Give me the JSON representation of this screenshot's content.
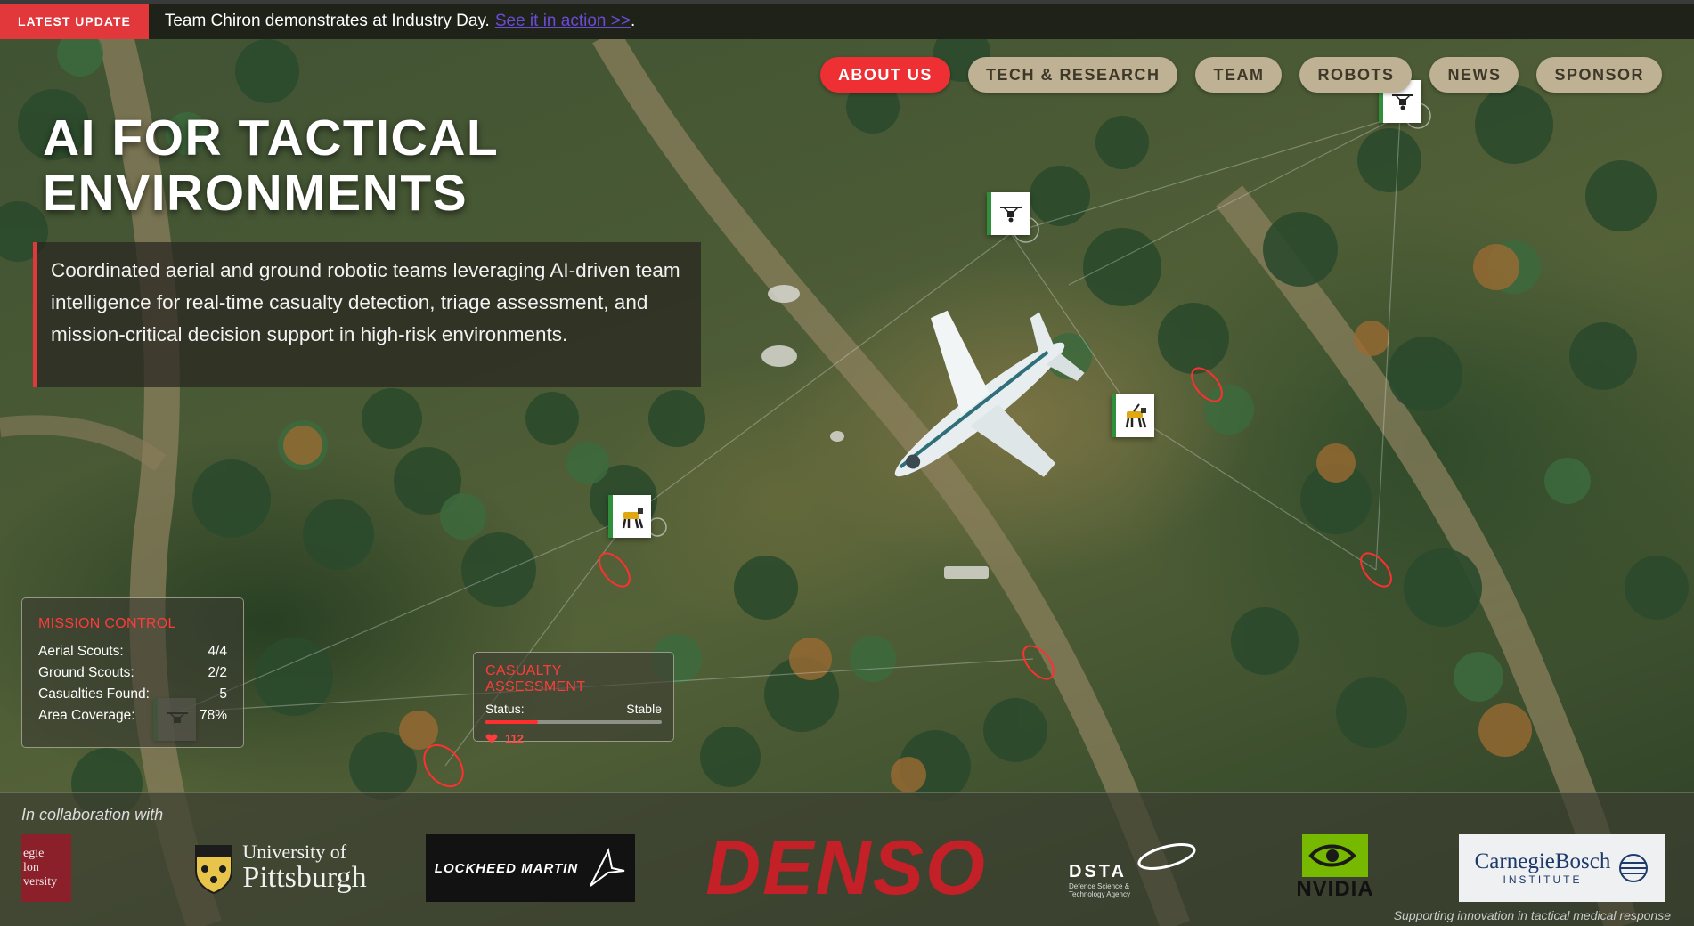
{
  "ticker": {
    "badge": "LATEST UPDATE",
    "text": "Team Chiron demonstrates at Industry Day.",
    "link": "See it in action >>",
    "suffix": "."
  },
  "nav": {
    "items": [
      {
        "label": "ABOUT US",
        "active": true
      },
      {
        "label": "TECH & RESEARCH",
        "active": false
      },
      {
        "label": "TEAM",
        "active": false
      },
      {
        "label": "ROBOTS",
        "active": false
      },
      {
        "label": "NEWS",
        "active": false
      },
      {
        "label": "SPONSOR",
        "active": false
      }
    ]
  },
  "hero": {
    "title_line1": "AI FOR TACTICAL",
    "title_line2": "ENVIRONMENTS",
    "description": "Coordinated aerial and ground robotic teams leveraging AI-driven team intelligence for real-time casualty detection, triage assessment, and mission-critical decision support in high-risk environments."
  },
  "mission_control": {
    "title": "MISSION CONTROL",
    "rows": [
      {
        "label": "Aerial Scouts:",
        "value": "4/4"
      },
      {
        "label": "Ground Scouts:",
        "value": "2/2"
      },
      {
        "label": "Casualties Found:",
        "value": "5"
      },
      {
        "label": "Area Coverage:",
        "value": "78%"
      }
    ]
  },
  "casualty_assessment": {
    "title": "CASUALTY ASSESSMENT",
    "status_label": "Status:",
    "status_value": "Stable",
    "progress": 0.3,
    "heart_rate": "112"
  },
  "partners": {
    "heading": "In collaboration with",
    "logos": [
      {
        "name": "Carnegie Mellon University",
        "text_lines": [
          "egie",
          "lon",
          "versity"
        ]
      },
      {
        "name": "University of Pittsburgh",
        "line1": "University of",
        "line2": "Pittsburgh"
      },
      {
        "name": "Lockheed Martin",
        "text": "LOCKHEED MARTIN"
      },
      {
        "name": "DENSO",
        "text": "DENSO"
      },
      {
        "name": "DSTA",
        "text": "DSTA",
        "sub1": "Defence Science &",
        "sub2": "Technology Agency"
      },
      {
        "name": "NVIDIA",
        "text": "NVIDIA"
      },
      {
        "name": "CarnegieBosch Institute",
        "line1": "CarnegieBosch",
        "line2": "INSTITUTE"
      }
    ],
    "footnote": "Supporting innovation in tactical medical response"
  },
  "colors": {
    "accent_red": "#e2383c",
    "nav_tan": "#bfb194",
    "robot_green": "#2f8f3a"
  },
  "icons": [
    "drone-icon",
    "robot-dog-icon",
    "heart-icon",
    "target-circle-icon"
  ]
}
